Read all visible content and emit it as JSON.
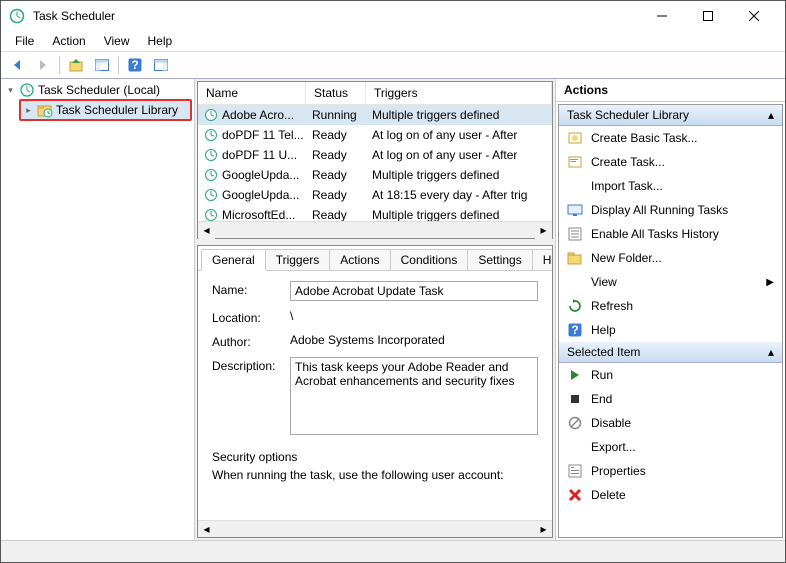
{
  "window": {
    "title": "Task Scheduler"
  },
  "menubar": [
    "File",
    "Action",
    "View",
    "Help"
  ],
  "tree": {
    "root": "Task Scheduler (Local)",
    "child": "Task Scheduler Library"
  },
  "task_list": {
    "columns": [
      "Name",
      "Status",
      "Triggers"
    ],
    "rows": [
      {
        "name": "Adobe Acro...",
        "status": "Running",
        "triggers": "Multiple triggers defined"
      },
      {
        "name": "doPDF 11 Tel...",
        "status": "Ready",
        "triggers": "At log on of any user - After"
      },
      {
        "name": "doPDF 11 U...",
        "status": "Ready",
        "triggers": "At log on of any user - After"
      },
      {
        "name": "GoogleUpda...",
        "status": "Ready",
        "triggers": "Multiple triggers defined"
      },
      {
        "name": "GoogleUpda...",
        "status": "Ready",
        "triggers": "At 18:15 every day - After trig"
      },
      {
        "name": "MicrosoftEd...",
        "status": "Ready",
        "triggers": "Multiple triggers defined"
      }
    ]
  },
  "tabs": [
    "General",
    "Triggers",
    "Actions",
    "Conditions",
    "Settings",
    "H"
  ],
  "general": {
    "name_label": "Name:",
    "name_value": "Adobe Acrobat Update Task",
    "location_label": "Location:",
    "location_value": "\\",
    "author_label": "Author:",
    "author_value": "Adobe Systems Incorporated",
    "description_label": "Description:",
    "description_value": "This task keeps your Adobe Reader and Acrobat enhancements and security fixes",
    "security_header": "Security options",
    "security_line1": "When running the task, use the following user account:"
  },
  "actions": {
    "header": "Actions",
    "section1_title": "Task Scheduler Library",
    "section1_items": [
      "Create Basic Task...",
      "Create Task...",
      "Import Task...",
      "Display All Running Tasks",
      "Enable All Tasks History",
      "New Folder...",
      "View",
      "Refresh",
      "Help"
    ],
    "section2_title": "Selected Item",
    "section2_items": [
      "Run",
      "End",
      "Disable",
      "Export...",
      "Properties",
      "Delete"
    ]
  }
}
